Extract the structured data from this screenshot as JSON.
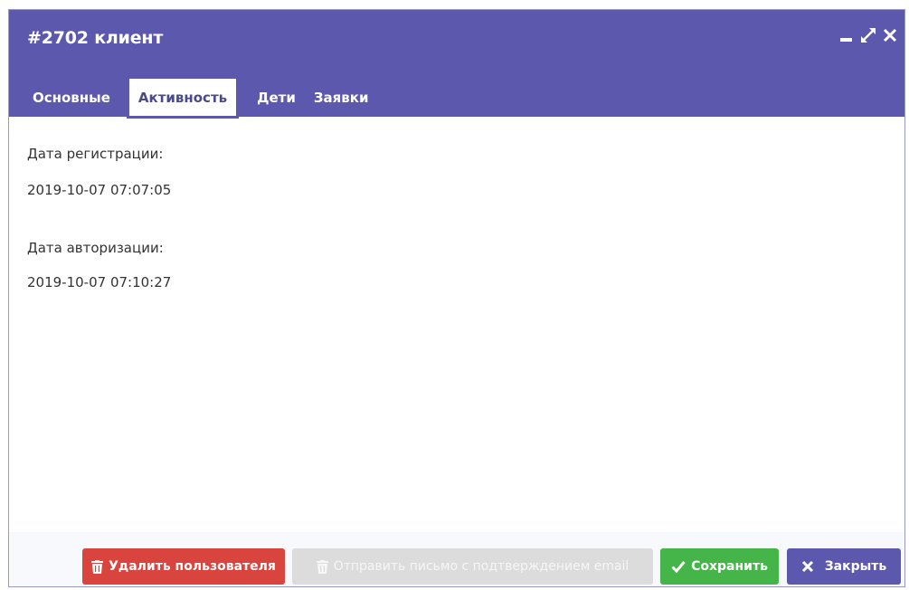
{
  "dialog": {
    "title": "#2702 клиент",
    "controls": [
      "minimize-icon",
      "maximize-icon",
      "close-icon"
    ]
  },
  "tabs": [
    {
      "label": "Основные",
      "active": false
    },
    {
      "label": "Активность",
      "active": true
    },
    {
      "label": "Дети",
      "active": false
    },
    {
      "label": "Заявки",
      "active": false
    }
  ],
  "activity": {
    "registration_label": "Дата регистрации:",
    "registration_value": "2019-10-07 07:07:05",
    "authorization_label": "Дата авторизации:",
    "authorization_value": "2019-10-07 07:10:27"
  },
  "footer": {
    "delete_label": "Удалить пользователя",
    "send_email_label": "Отправить письмо с подтверждением email",
    "save_label": "Сохранить",
    "close_label": "Закрыть"
  },
  "colors": {
    "header": "#5c58ad",
    "delete": "#d9443f",
    "save": "#45b549",
    "disabled": "#dcdcdc"
  }
}
